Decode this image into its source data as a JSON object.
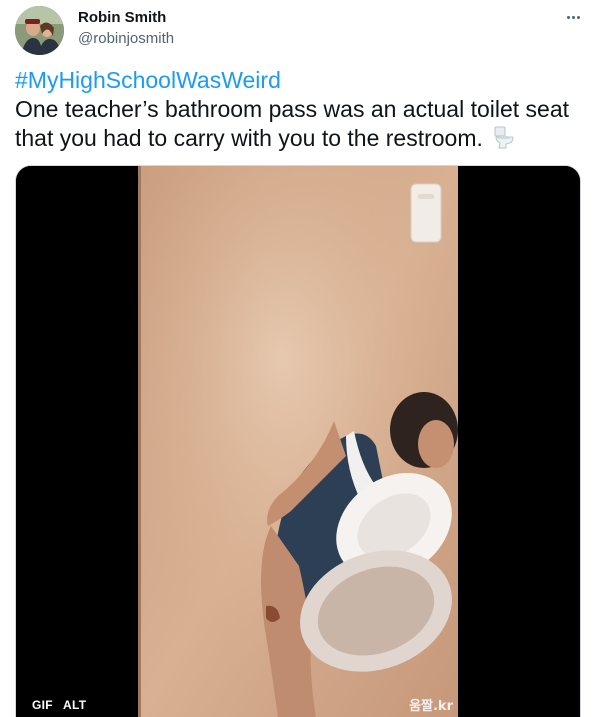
{
  "author": {
    "name": "Robin Smith",
    "handle": "@robinjosmith"
  },
  "tweet": {
    "hashtag": "#MyHighSchoolWasWeird",
    "text": "One teacher’s bathroom pass was an actual toilet seat that you had to carry with you to the restroom.",
    "emoji": "toilet-icon"
  },
  "media": {
    "gif_badge": "GIF",
    "alt_badge": "ALT",
    "watermark": "움짤.kr"
  },
  "colors": {
    "hashtag": "#1d9bf0",
    "handle": "#536471",
    "media_background": "#000000"
  }
}
